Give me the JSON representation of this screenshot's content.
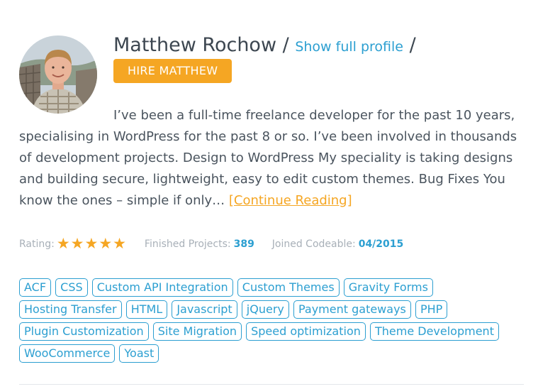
{
  "profile": {
    "name": "Matthew Rochow",
    "separator": "/",
    "profile_link_label": "Show full profile",
    "hire_label": "HIRE MATTHEW"
  },
  "bio": {
    "text": "I’ve been a full-time freelance developer for the past 10 years, specialising in WordPress for the past 8 or so. I’ve been involved in thousands of development projects. Design to WordPress My speciality is taking designs and building secure, lightweight, easy to edit custom themes. Bug Fixes You know the ones – simple if only… ",
    "continue_label": "[Continue Reading]"
  },
  "meta": {
    "rating_label": "Rating:",
    "rating_stars": "★★★★★",
    "rating_value": 5,
    "projects_label": "Finished Projects:",
    "projects_value": "389",
    "joined_label": "Joined Codeable:",
    "joined_value": "04/2015"
  },
  "tags": [
    "ACF",
    "CSS",
    "Custom API Integration",
    "Custom Themes",
    "Gravity Forms",
    "Hosting Transfer",
    "HTML",
    "Javascript",
    "jQuery",
    "Payment gateways",
    "PHP",
    "Plugin Customization",
    "Site Migration",
    "Speed optimization",
    "Theme Development",
    "WooCommerce",
    "Yoast"
  ],
  "colors": {
    "accent_blue": "#2c9fd1",
    "accent_orange": "#f5a623",
    "text": "#4a545e",
    "muted": "#a8b0b8"
  }
}
